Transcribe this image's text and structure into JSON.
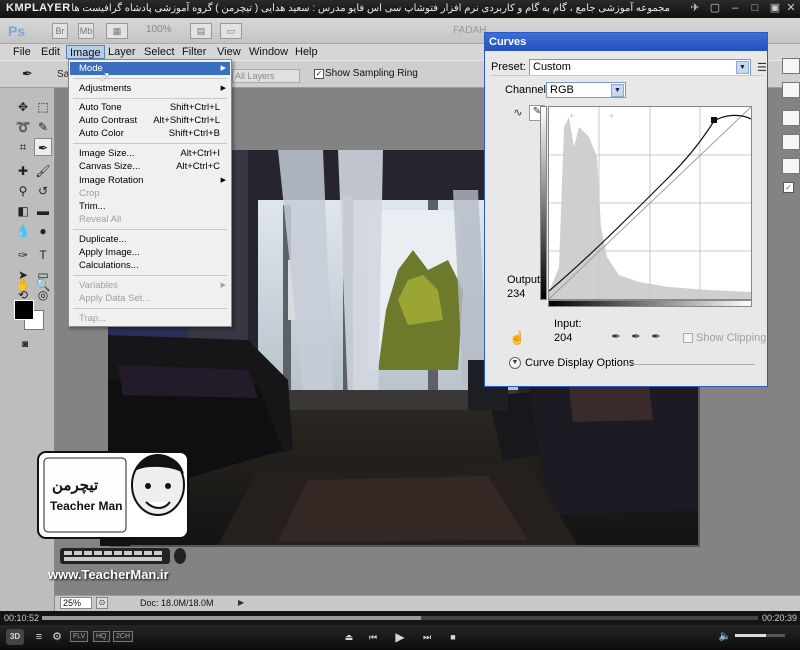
{
  "player": {
    "logo": "KMPLAYER",
    "caption": "مجموعه آموزشی جامع ، گام به گام و کاربردی نرم افزار فتوشاپ سی اس فایو  مدرس : سعید هدایی ( تیچرمن ) گروه آموزشی پادشاه گرافیست ها",
    "time_elapsed": "00:10:52",
    "time_total": "00:20:39",
    "progress": 0.53,
    "volume": 0.62,
    "badges": [
      "FLV",
      "HQ",
      "2CH"
    ]
  },
  "photoshop": {
    "appbar": {
      "logo": "Ps",
      "zoom": "100%",
      "workspace_label": "FADAH"
    },
    "menubar": [
      "File",
      "Edit",
      "Image",
      "Layer",
      "Select",
      "Filter",
      "View",
      "Window",
      "Help"
    ],
    "active_menu": "Image",
    "options": {
      "sample_label": "Sa",
      "sample_value": "All Layers",
      "show_ring": "Show Sampling Ring"
    },
    "status": {
      "zoom": "25%",
      "doc": "Doc: 18.0M/18.0M"
    }
  },
  "image_menu": {
    "items": [
      {
        "label": "Mode",
        "shortcut": "",
        "submenu": true,
        "disabled": false,
        "highlight": true
      },
      {
        "label": "Adjustments",
        "shortcut": "",
        "submenu": true,
        "disabled": false
      },
      {
        "label": "Auto Tone",
        "shortcut": "Shift+Ctrl+L",
        "submenu": false,
        "disabled": false
      },
      {
        "label": "Auto Contrast",
        "shortcut": "Alt+Shift+Ctrl+L",
        "submenu": false,
        "disabled": false
      },
      {
        "label": "Auto Color",
        "shortcut": "Shift+Ctrl+B",
        "submenu": false,
        "disabled": false
      },
      {
        "label": "Image Size...",
        "shortcut": "Alt+Ctrl+I",
        "submenu": false,
        "disabled": false
      },
      {
        "label": "Canvas Size...",
        "shortcut": "Alt+Ctrl+C",
        "submenu": false,
        "disabled": false
      },
      {
        "label": "Image Rotation",
        "shortcut": "",
        "submenu": true,
        "disabled": false
      },
      {
        "label": "Crop",
        "shortcut": "",
        "submenu": false,
        "disabled": true
      },
      {
        "label": "Trim...",
        "shortcut": "",
        "submenu": false,
        "disabled": false
      },
      {
        "label": "Reveal All",
        "shortcut": "",
        "submenu": false,
        "disabled": true
      },
      {
        "label": "Duplicate...",
        "shortcut": "",
        "submenu": false,
        "disabled": false
      },
      {
        "label": "Apply Image...",
        "shortcut": "",
        "submenu": false,
        "disabled": false
      },
      {
        "label": "Calculations...",
        "shortcut": "",
        "submenu": false,
        "disabled": false
      },
      {
        "label": "Variables",
        "shortcut": "",
        "submenu": true,
        "disabled": true
      },
      {
        "label": "Apply Data Set...",
        "shortcut": "",
        "submenu": false,
        "disabled": true
      },
      {
        "label": "Trap...",
        "shortcut": "",
        "submenu": false,
        "disabled": true
      }
    ]
  },
  "curves": {
    "title": "Curves",
    "preset_label": "Preset:",
    "preset_value": "Custom",
    "channel_label": "Channel:",
    "channel_value": "RGB",
    "output_label": "Output:",
    "output_value": "234",
    "input_label": "Input:",
    "input_value": "204",
    "show_clipping": "Show Clipping",
    "display_options": "Curve Display Options"
  },
  "watermark": {
    "brand": "Teacher Man",
    "url": "www.TeacherMan.ir"
  },
  "colors": {
    "accent": "#2451bc",
    "menu_highlight": "#3a6fc0"
  }
}
